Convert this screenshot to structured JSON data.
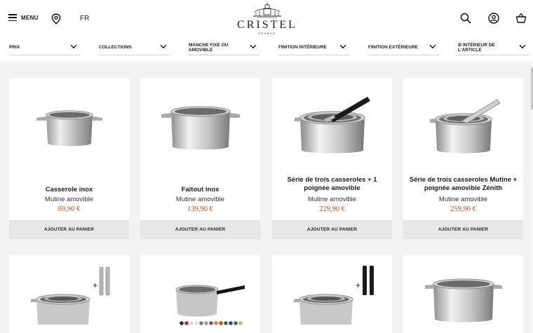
{
  "header": {
    "menu_label": "MENU",
    "lang": "FR",
    "logo_text": "CRISTEL",
    "logo_sub": "FRANCE"
  },
  "filters": [
    {
      "label": "PRIX"
    },
    {
      "label": "COLLECTIONS"
    },
    {
      "label": "MANCHE FIXE OU AMOVIBLE"
    },
    {
      "label": "FINITION INTÉRIEURE"
    },
    {
      "label": "FINITION EXTÉRIEURE"
    },
    {
      "label": "Ø INTÉRIEUR DE L'ARTICLE"
    }
  ],
  "products": [
    {
      "name": "Casserole inox",
      "sub": "Mutine amovible",
      "price": "69,90 €",
      "button": "AJOUTER AU PANIER"
    },
    {
      "name": "Faitout inox",
      "sub": "Mutine amovible",
      "price": "139,90 €",
      "button": "AJOUTER AU PANIER"
    },
    {
      "name": "Série de trois casseroles + 1 poignée amovible",
      "sub": "Mutine amovible",
      "price": "229,90 €",
      "button": "AJOUTER AU PANIER"
    },
    {
      "name": "Série de trois casseroles Mutine + poignée amovible Zénith",
      "sub": "Mutine amovible",
      "price": "259,90 €",
      "button": "AJOUTER AU PANIER"
    }
  ],
  "swatch_colors": [
    "#1c2a44",
    "#b52a20",
    "#d9d9d9",
    "#e7e2d8",
    "#7c7c7c",
    "#9b9b9b",
    "#6d5a8c",
    "#e28c2b",
    "#c0531f",
    "#2a6f5b",
    "#1f4f8c",
    "#4a6e2a",
    "#b5b58a"
  ],
  "colors": {
    "price": "#c14a1f",
    "button_bg": "#e6e6e6",
    "page_bg": "#f2f2f2"
  }
}
